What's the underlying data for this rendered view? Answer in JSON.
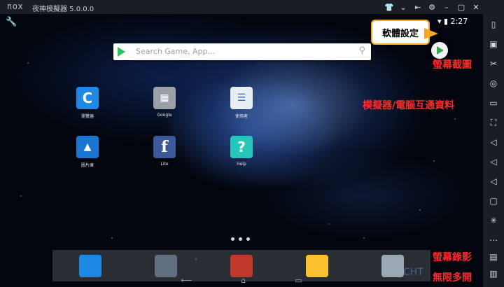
{
  "window": {
    "logo_text": "nox",
    "title": "夜神模擬器 5.0.0.0",
    "buttons": [
      "shirt-icon",
      "chevron-down-icon",
      "keyboard-icon",
      "gear-icon",
      "minimize-icon",
      "maximize-icon",
      "close-icon"
    ]
  },
  "status": {
    "time": "2:27"
  },
  "search": {
    "placeholder": "Search Game, App..."
  },
  "apps": [
    {
      "label": "瀏覽器",
      "color": "#1e88e5",
      "glyph": "C"
    },
    {
      "label": "Google",
      "color": "#9aa0a6",
      "glyph": "▦"
    },
    {
      "label": "使用者",
      "color": "#e8eef6",
      "glyph": "☰"
    },
    {
      "label": "圖片庫",
      "color": "#1976d2",
      "glyph": "▲"
    },
    {
      "label": "Lite",
      "color": "#3b5998",
      "glyph": "f"
    },
    {
      "label": "Help",
      "color": "#26c6b8",
      "glyph": "?"
    }
  ],
  "dock": [
    {
      "name": "file-manager",
      "color": "#1e88e5"
    },
    {
      "name": "camera",
      "color": "#607080"
    },
    {
      "name": "game",
      "color": "#c0392b"
    },
    {
      "name": "notes",
      "color": "#fbc02d"
    },
    {
      "name": "settings",
      "color": "#9aa7b4"
    }
  ],
  "callout": {
    "text": "軟體設定"
  },
  "annotations": {
    "screenshot": "螢幕截圖",
    "file_share": "模擬器/電腦互通資料",
    "record": "螢幕錄影",
    "multi_instance": "無限多開"
  },
  "watermark": "CHT",
  "colors": {
    "annotation": "#ff2b2b",
    "callout_border": "#f5a623"
  }
}
